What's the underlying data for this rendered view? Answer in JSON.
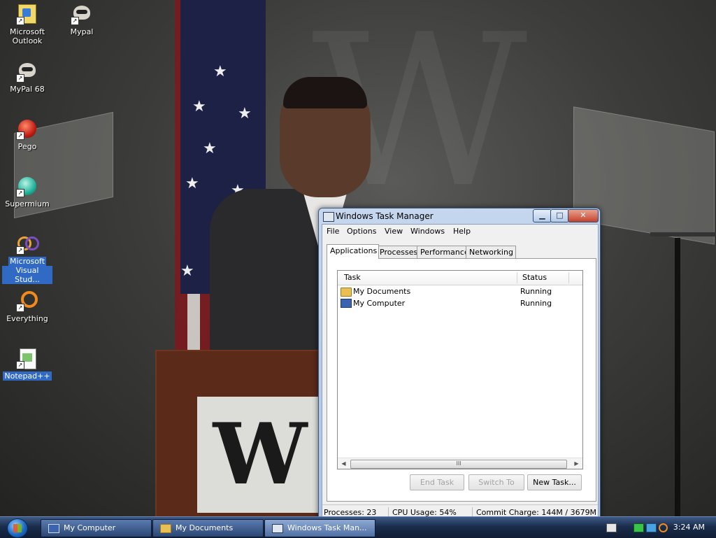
{
  "desktop": {
    "icons": [
      {
        "label_line1": "Microsoft",
        "label_line2": "Outlook"
      },
      {
        "label_line1": "Mypal"
      },
      {
        "label_line1": "MyPal 68"
      },
      {
        "label_line1": "Pego"
      },
      {
        "label_line1": "Supermium"
      },
      {
        "label_line1": "Microsoft",
        "label_line2": "Visual Stud..."
      },
      {
        "label_line1": "Everything"
      },
      {
        "label_line1": "Notepad++"
      }
    ]
  },
  "window": {
    "title": "Windows Task Manager",
    "controls": {
      "minimize": "▁",
      "maximize": "□",
      "close": "✕"
    },
    "menu": [
      "File",
      "Options",
      "View",
      "Windows",
      "Help"
    ],
    "tabs": [
      "Applications",
      "Processes",
      "Performance",
      "Networking"
    ],
    "active_tab": "Applications",
    "columns": {
      "task": "Task",
      "status": "Status"
    },
    "rows": [
      {
        "task": "My Documents",
        "status": "Running",
        "icon": "folder-icon"
      },
      {
        "task": "My Computer",
        "status": "Running",
        "icon": "computer-icon"
      }
    ],
    "scroll_grip": "III",
    "buttons": {
      "end_task": "End Task",
      "switch_to": "Switch To",
      "new_task": "New Task..."
    },
    "status": {
      "processes": "Processes: 23",
      "cpu": "CPU Usage: 54%",
      "commit": "Commit Charge: 144M / 3679M"
    }
  },
  "taskbar": {
    "items": [
      {
        "label": "My Computer",
        "icon": "computer-icon"
      },
      {
        "label": "My Documents",
        "icon": "folder-icon"
      },
      {
        "label": "Windows Task Man...",
        "icon": "task-manager-icon"
      }
    ],
    "clock": "3:24 AM"
  },
  "colors": {
    "selection": "#316ac5",
    "taskbar": "#1b2d4d"
  }
}
